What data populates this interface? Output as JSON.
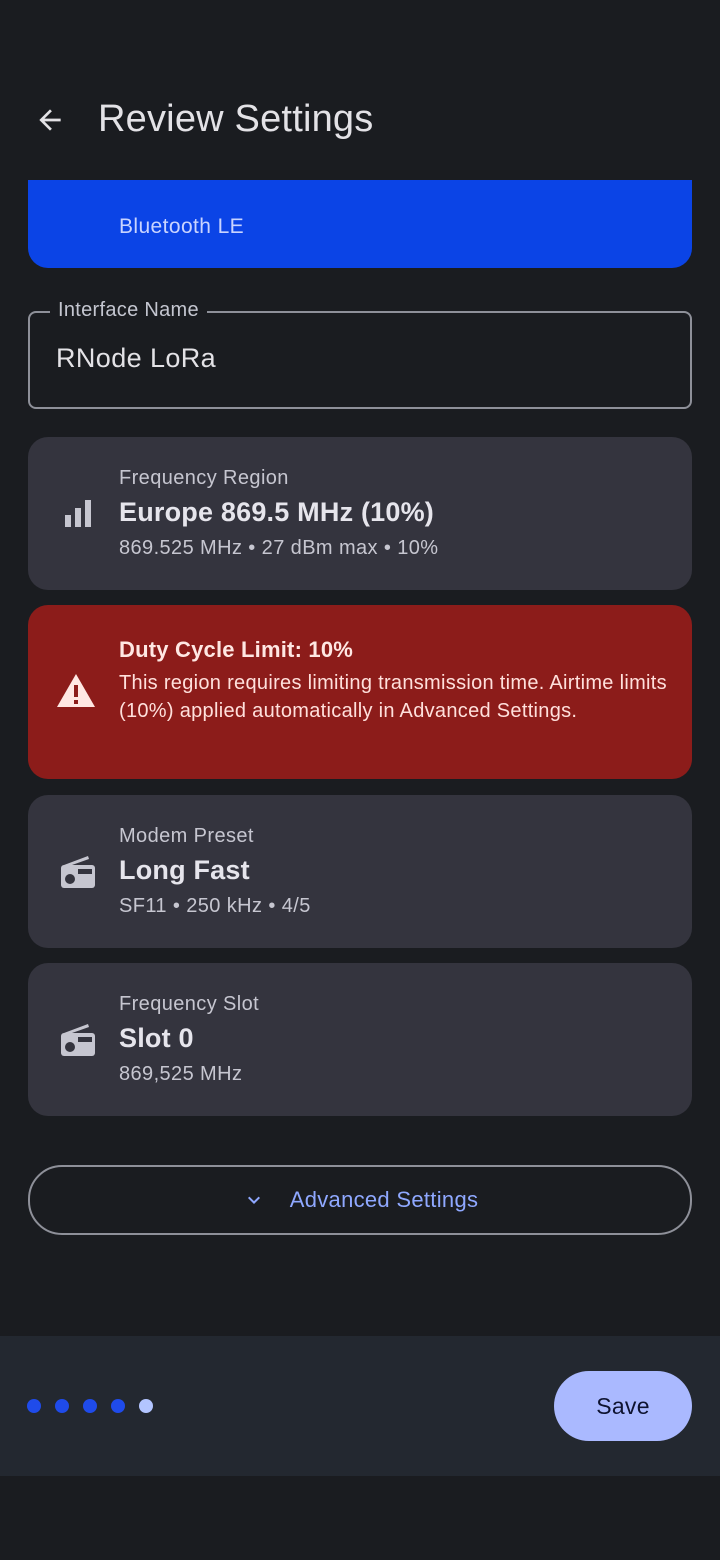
{
  "header": {
    "title": "Review Settings"
  },
  "connection": {
    "subtitle": "Bluetooth LE"
  },
  "interface_name": {
    "label": "Interface Name",
    "value": "RNode LoRa"
  },
  "frequency_region": {
    "label": "Frequency Region",
    "value": "Europe 869.5 MHz (10%)",
    "detail": "869.525 MHz • 27 dBm max • 10%",
    "icon": "signal-bars-icon"
  },
  "warning": {
    "title": "Duty Cycle Limit: 10%",
    "body": "This region requires limiting transmission time. Airtime limits (10%) applied automatically in Advanced Settings.",
    "icon": "warning-icon",
    "color": "#8c1c1a"
  },
  "modem_preset": {
    "label": "Modem Preset",
    "value": "Long Fast",
    "detail": "SF11 • 250 kHz • 4/5",
    "icon": "radio-icon"
  },
  "frequency_slot": {
    "label": "Frequency Slot",
    "value": "Slot 0",
    "detail": "869,525 MHz",
    "icon": "radio-icon"
  },
  "advanced": {
    "label": "Advanced Settings"
  },
  "footer": {
    "steps_total": 5,
    "current_step": 5,
    "save_label": "Save"
  },
  "colors": {
    "accent": "#aab9ff",
    "connection_card": "#0b44e6",
    "card": "#34343e",
    "background": "#1a1c20"
  }
}
